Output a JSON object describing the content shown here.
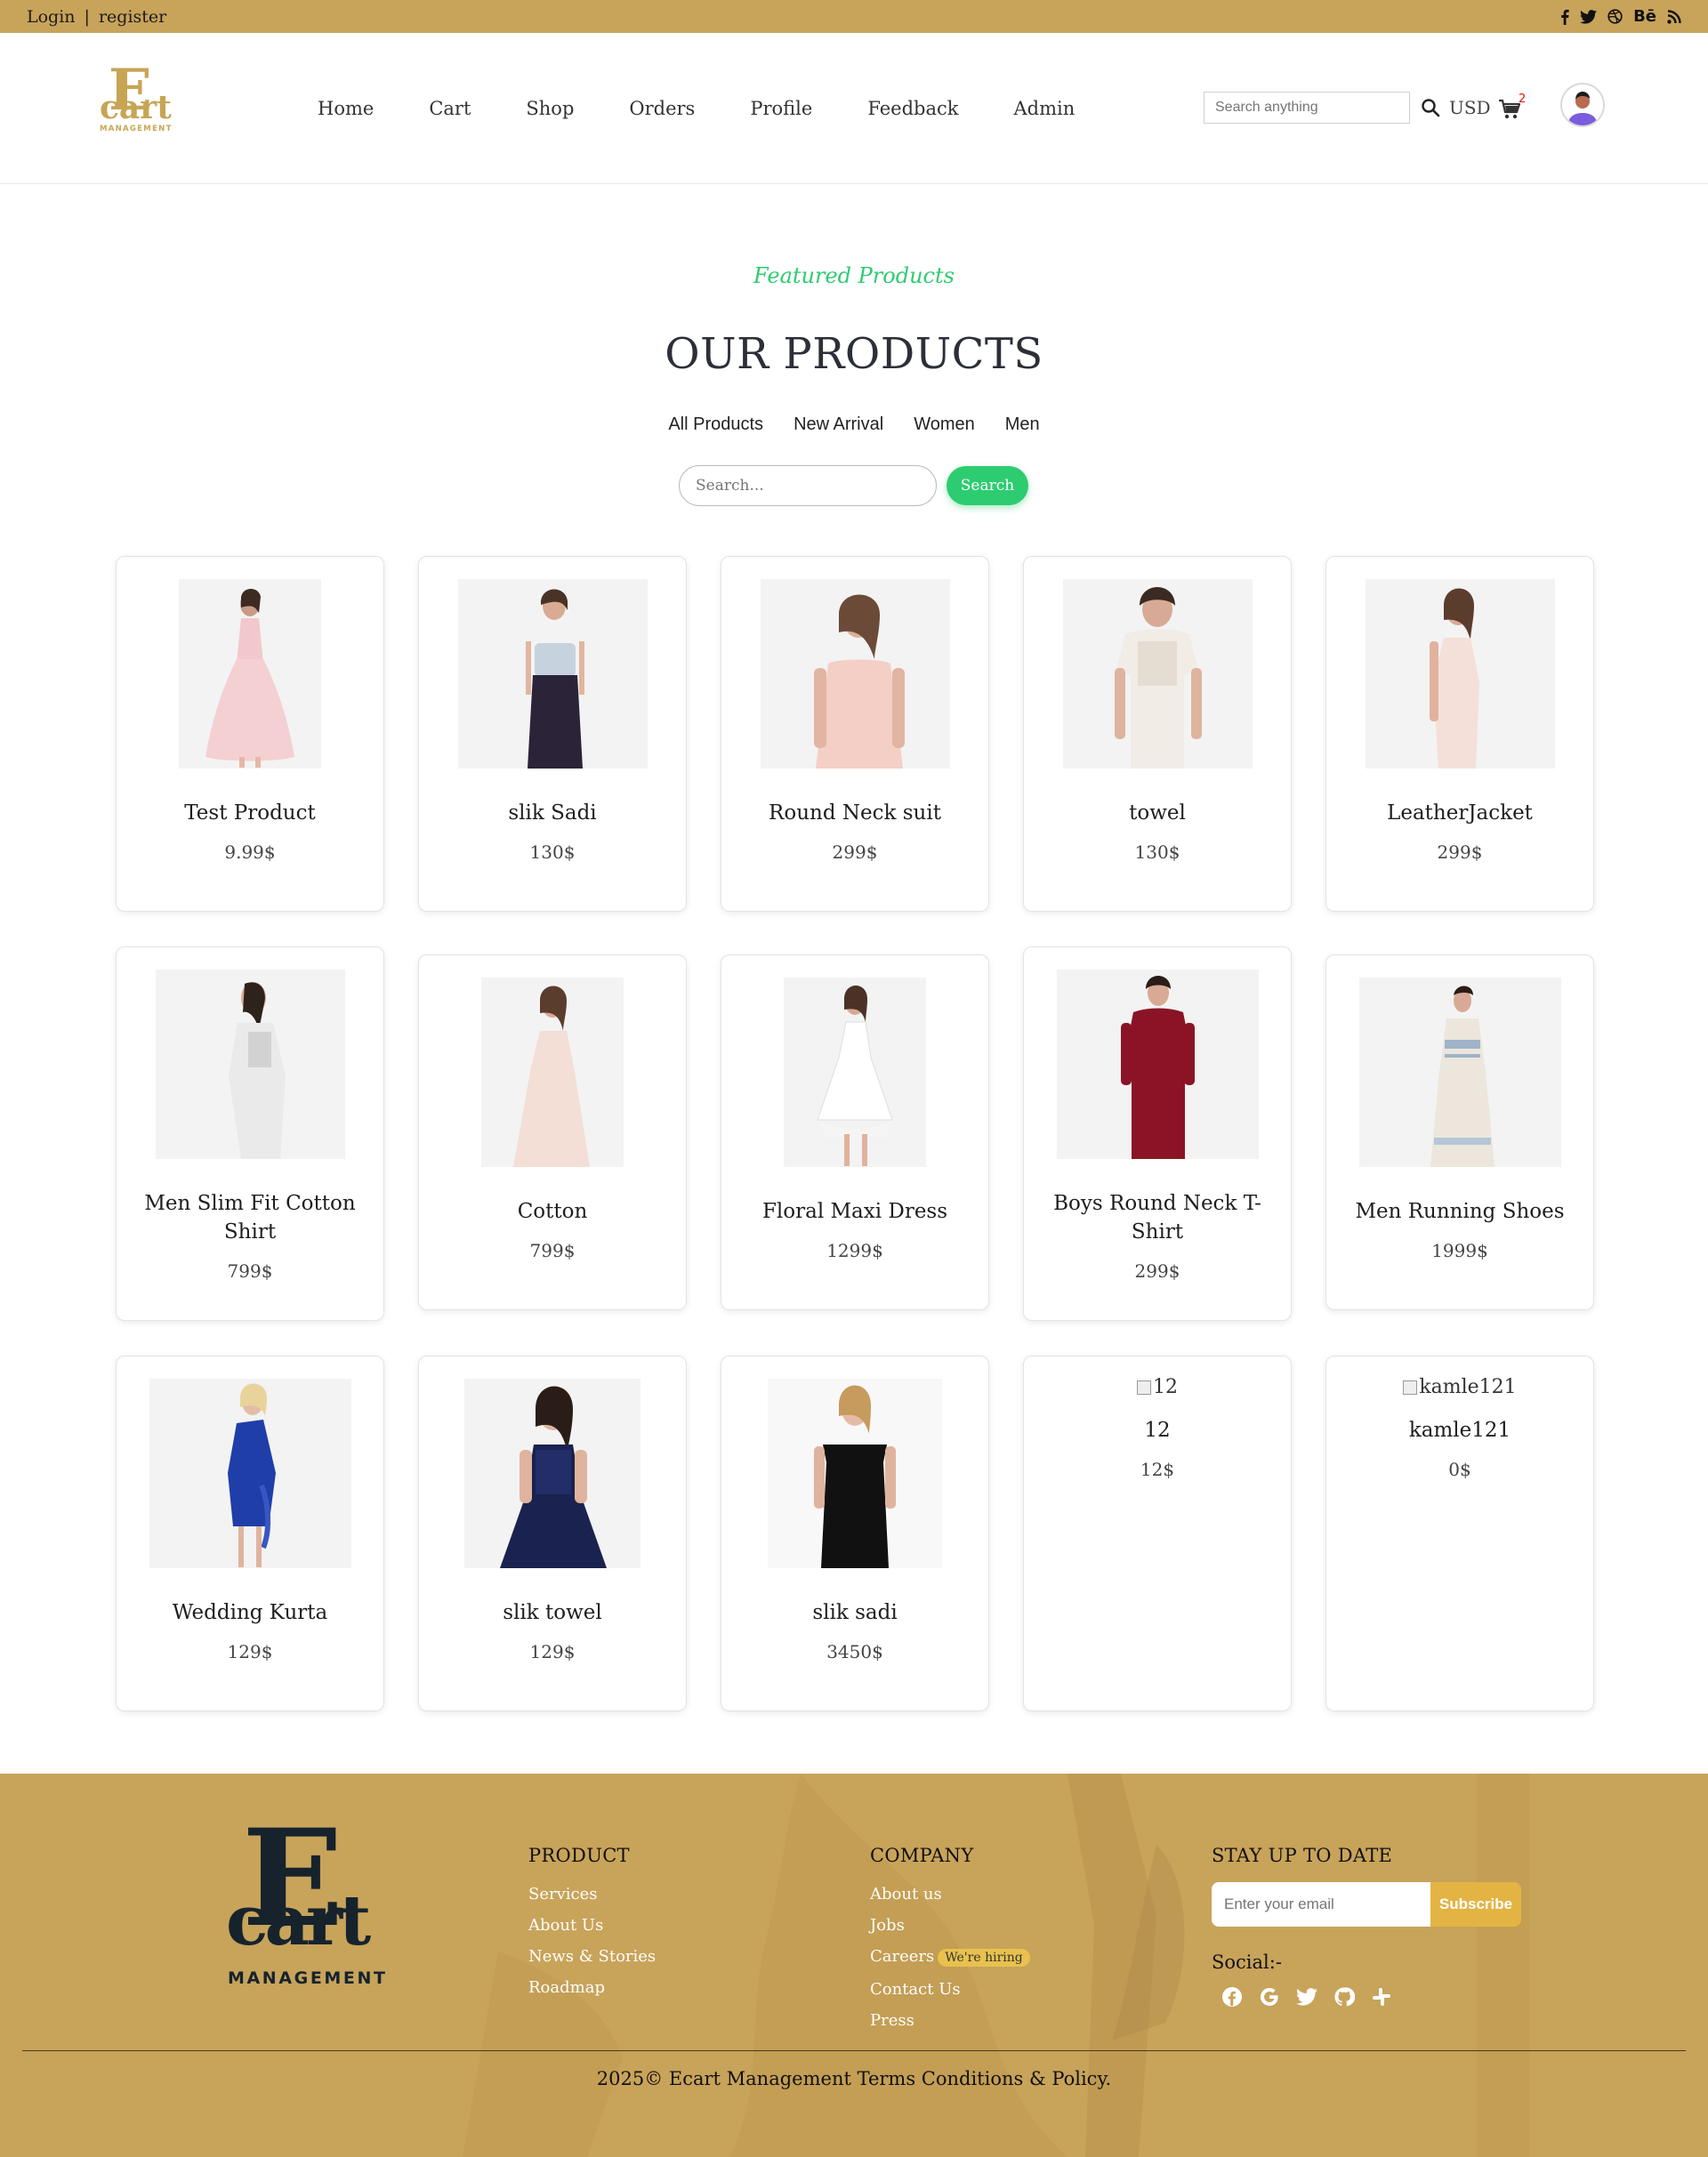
{
  "topbar": {
    "login": "Login",
    "separator": "|",
    "register": "register",
    "social_icons": [
      "facebook-icon",
      "twitter-icon",
      "dribbble-icon",
      "behance-icon",
      "rss-icon"
    ],
    "behance_text": "Bē"
  },
  "header": {
    "logo": {
      "letter": "E",
      "word": "cart",
      "sub": "MANAGEMENT"
    },
    "nav": [
      "Home",
      "Cart",
      "Shop",
      "Orders",
      "Profile",
      "Feedback",
      "Admin"
    ],
    "search_placeholder": "Search anything",
    "currency": "USD",
    "cart_count": "2"
  },
  "products_section": {
    "eyebrow": "Featured Products",
    "title": "OUR PRODUCTS",
    "filters": [
      "All Products",
      "New Arrival",
      "Women",
      "Men"
    ],
    "search_placeholder": "Search...",
    "search_button": "Search",
    "products": [
      {
        "name": "Test Product",
        "price": "9.99$"
      },
      {
        "name": "slik Sadi",
        "price": "130$"
      },
      {
        "name": "Round Neck suit",
        "price": "299$"
      },
      {
        "name": "towel",
        "price": "130$"
      },
      {
        "name": "LeatherJacket",
        "price": "299$"
      },
      {
        "name": "Men Slim Fit Cotton Shirt",
        "price": "799$"
      },
      {
        "name": "Cotton",
        "price": "799$"
      },
      {
        "name": "Floral Maxi Dress",
        "price": "1299$"
      },
      {
        "name": "Boys Round Neck T-Shirt",
        "price": "299$"
      },
      {
        "name": "Men Running Shoes",
        "price": "1999$"
      },
      {
        "name": "Wedding Kurta",
        "price": "129$"
      },
      {
        "name": "slik towel",
        "price": "129$"
      },
      {
        "name": "slik sadi",
        "price": "3450$"
      },
      {
        "name": "12",
        "price": "12$",
        "alt": "12"
      },
      {
        "name": "kamle121",
        "price": "0$",
        "alt": "kamle121"
      }
    ]
  },
  "footer": {
    "logo": {
      "letter": "E",
      "word": "cart",
      "sub": "MANAGEMENT"
    },
    "product": {
      "title": "PRODUCT",
      "links": [
        "Services",
        "About Us",
        "News & Stories",
        "Roadmap"
      ]
    },
    "company": {
      "title": "COMPANY",
      "links": [
        "About us",
        "Jobs",
        "Careers",
        "Contact Us",
        "Press"
      ],
      "hiring_badge": "We're hiring"
    },
    "newsletter": {
      "title": "STAY UP TO DATE",
      "placeholder": "Enter your email",
      "button": "Subscribe"
    },
    "social_label": "Social:-",
    "social_icons": [
      "facebook-icon",
      "google-icon",
      "twitter-icon",
      "github-icon",
      "slack-icon"
    ],
    "copyright": "2025© Ecart Management Terms Conditions & Policy."
  },
  "colors": {
    "brand_gold": "#c8a35a",
    "accent_green": "#2ecc71",
    "subscribe": "#e3b443"
  }
}
